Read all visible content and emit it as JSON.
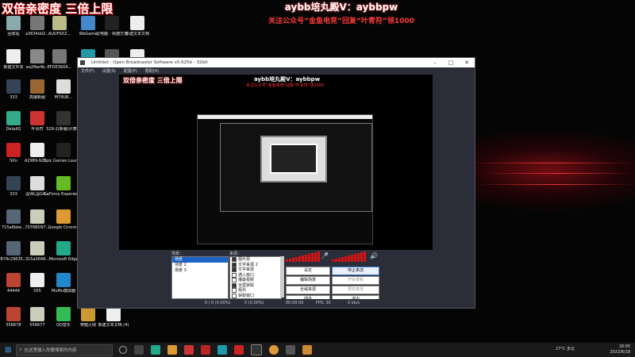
{
  "overlay": {
    "left_text": "双倍亲密度 三倍上限",
    "center_line1": "aybb培丸殿V：aybbpw",
    "center_line2": "关注公众号“金鱼电竞”回复“叶青符”领1000"
  },
  "desktop_icons": [
    {
      "label": "回收站",
      "color": "#8aa"
    },
    {
      "label": "a3634dd2...",
      "color": "#777"
    },
    {
      "label": "AUUFSXZ...",
      "color": "#bb8"
    },
    {
      "label": "WeGame",
      "color": "#48c"
    },
    {
      "label": "云电脑 - 快捷方式",
      "color": "#222"
    },
    {
      "label": "新建文本文档",
      "color": "#eee"
    },
    {
      "label": "新建文件夹",
      "color": "#eee"
    },
    {
      "label": "ea2fbe4b...",
      "color": "#888"
    },
    {
      "label": "EFDE360A...",
      "color": "#777"
    },
    {
      "label": "QQ",
      "color": "#29a"
    },
    {
      "label": "",
      "color": "#555"
    },
    {
      "label": "",
      "color": "#eee"
    },
    {
      "label": "333",
      "color": "#345"
    },
    {
      "label": "高爆新服",
      "color": "#963"
    },
    {
      "label": "M79UB...",
      "color": "#ddd"
    },
    {
      "label": "DetailQ",
      "color": "#3a8"
    },
    {
      "label": "叶青符",
      "color": "#c33"
    },
    {
      "label": "S29-2(新服)计算器",
      "color": "#333"
    },
    {
      "label": "Sifu",
      "color": "#c22"
    },
    {
      "label": "A2989-926...",
      "color": "#eee"
    },
    {
      "label": "Epic Games Launcher",
      "color": "#222"
    },
    {
      "label": "333",
      "color": "#345"
    },
    {
      "label": "@WL@G4...",
      "color": "#ddd"
    },
    {
      "label": "GeForce Experience",
      "color": "#6b2"
    },
    {
      "label": "715a6bbe...",
      "color": "#567"
    },
    {
      "label": "7076BD97...",
      "color": "#ccb"
    },
    {
      "label": "Google Chrome",
      "color": "#d93"
    },
    {
      "label": "B74c29635...",
      "color": "#567"
    },
    {
      "label": "315a3648...",
      "color": "#ccb"
    },
    {
      "label": "Microsoft Edge",
      "color": "#2a8"
    },
    {
      "label": "44444",
      "color": "#b43"
    },
    {
      "label": "555",
      "color": "#eee"
    },
    {
      "label": "MuMu模拟器",
      "color": "#28c"
    },
    {
      "label": "556678",
      "color": "#b43"
    },
    {
      "label": "556677",
      "color": "#ccb"
    },
    {
      "label": "QQ音乐",
      "color": "#3b5"
    },
    {
      "label": "穿越火线",
      "color": "#c93"
    },
    {
      "label": "新建文本文档 (4)",
      "color": "#eee"
    }
  ],
  "obs": {
    "title": "Untitled - Open Broadcaster Software v0.625b - 32bit",
    "menu": [
      "文件(F)",
      "设置(S)",
      "配置(P)",
      "帮助(H)"
    ],
    "scenes_header": "场景：",
    "scenes": [
      "场景",
      "场景 2",
      "场景 3"
    ],
    "sources_header": "来源：",
    "sources": [
      {
        "label": "图片源",
        "checked": true
      },
      {
        "label": "文字来源 2",
        "checked": true
      },
      {
        "label": "文字来源",
        "checked": true
      },
      {
        "label": "通入窗口",
        "checked": false
      },
      {
        "label": "播最视频",
        "checked": false
      },
      {
        "label": "全屏获取",
        "checked": true
      },
      {
        "label": "视讯",
        "checked": false
      },
      {
        "label": "获取窗口",
        "checked": false
      }
    ],
    "buttons": {
      "settings": "设定",
      "start_stream": "停止串流",
      "edit_scene": "编辑场景",
      "preview": "开始录制",
      "global_sources": "全域来源",
      "stop_rec": "预览串流",
      "plugins": "插件",
      "exit": "退出"
    },
    "status": {
      "dropped": "0 (0.00%)",
      "time": "00:00:00",
      "bitrate": "0 kb/s",
      "fps": "FPS: 30",
      "extra": "0 / 0 (0.00%)"
    }
  },
  "taskbar": {
    "search_placeholder": "在这里输入你要搜索的内容",
    "weather": "27°C 多云",
    "time": "18:00",
    "date": "2022/6/18"
  },
  "colors": {
    "accent_red": "#d11111",
    "obs_bg": "#2b2e38",
    "select_blue": "#1b63c5"
  }
}
